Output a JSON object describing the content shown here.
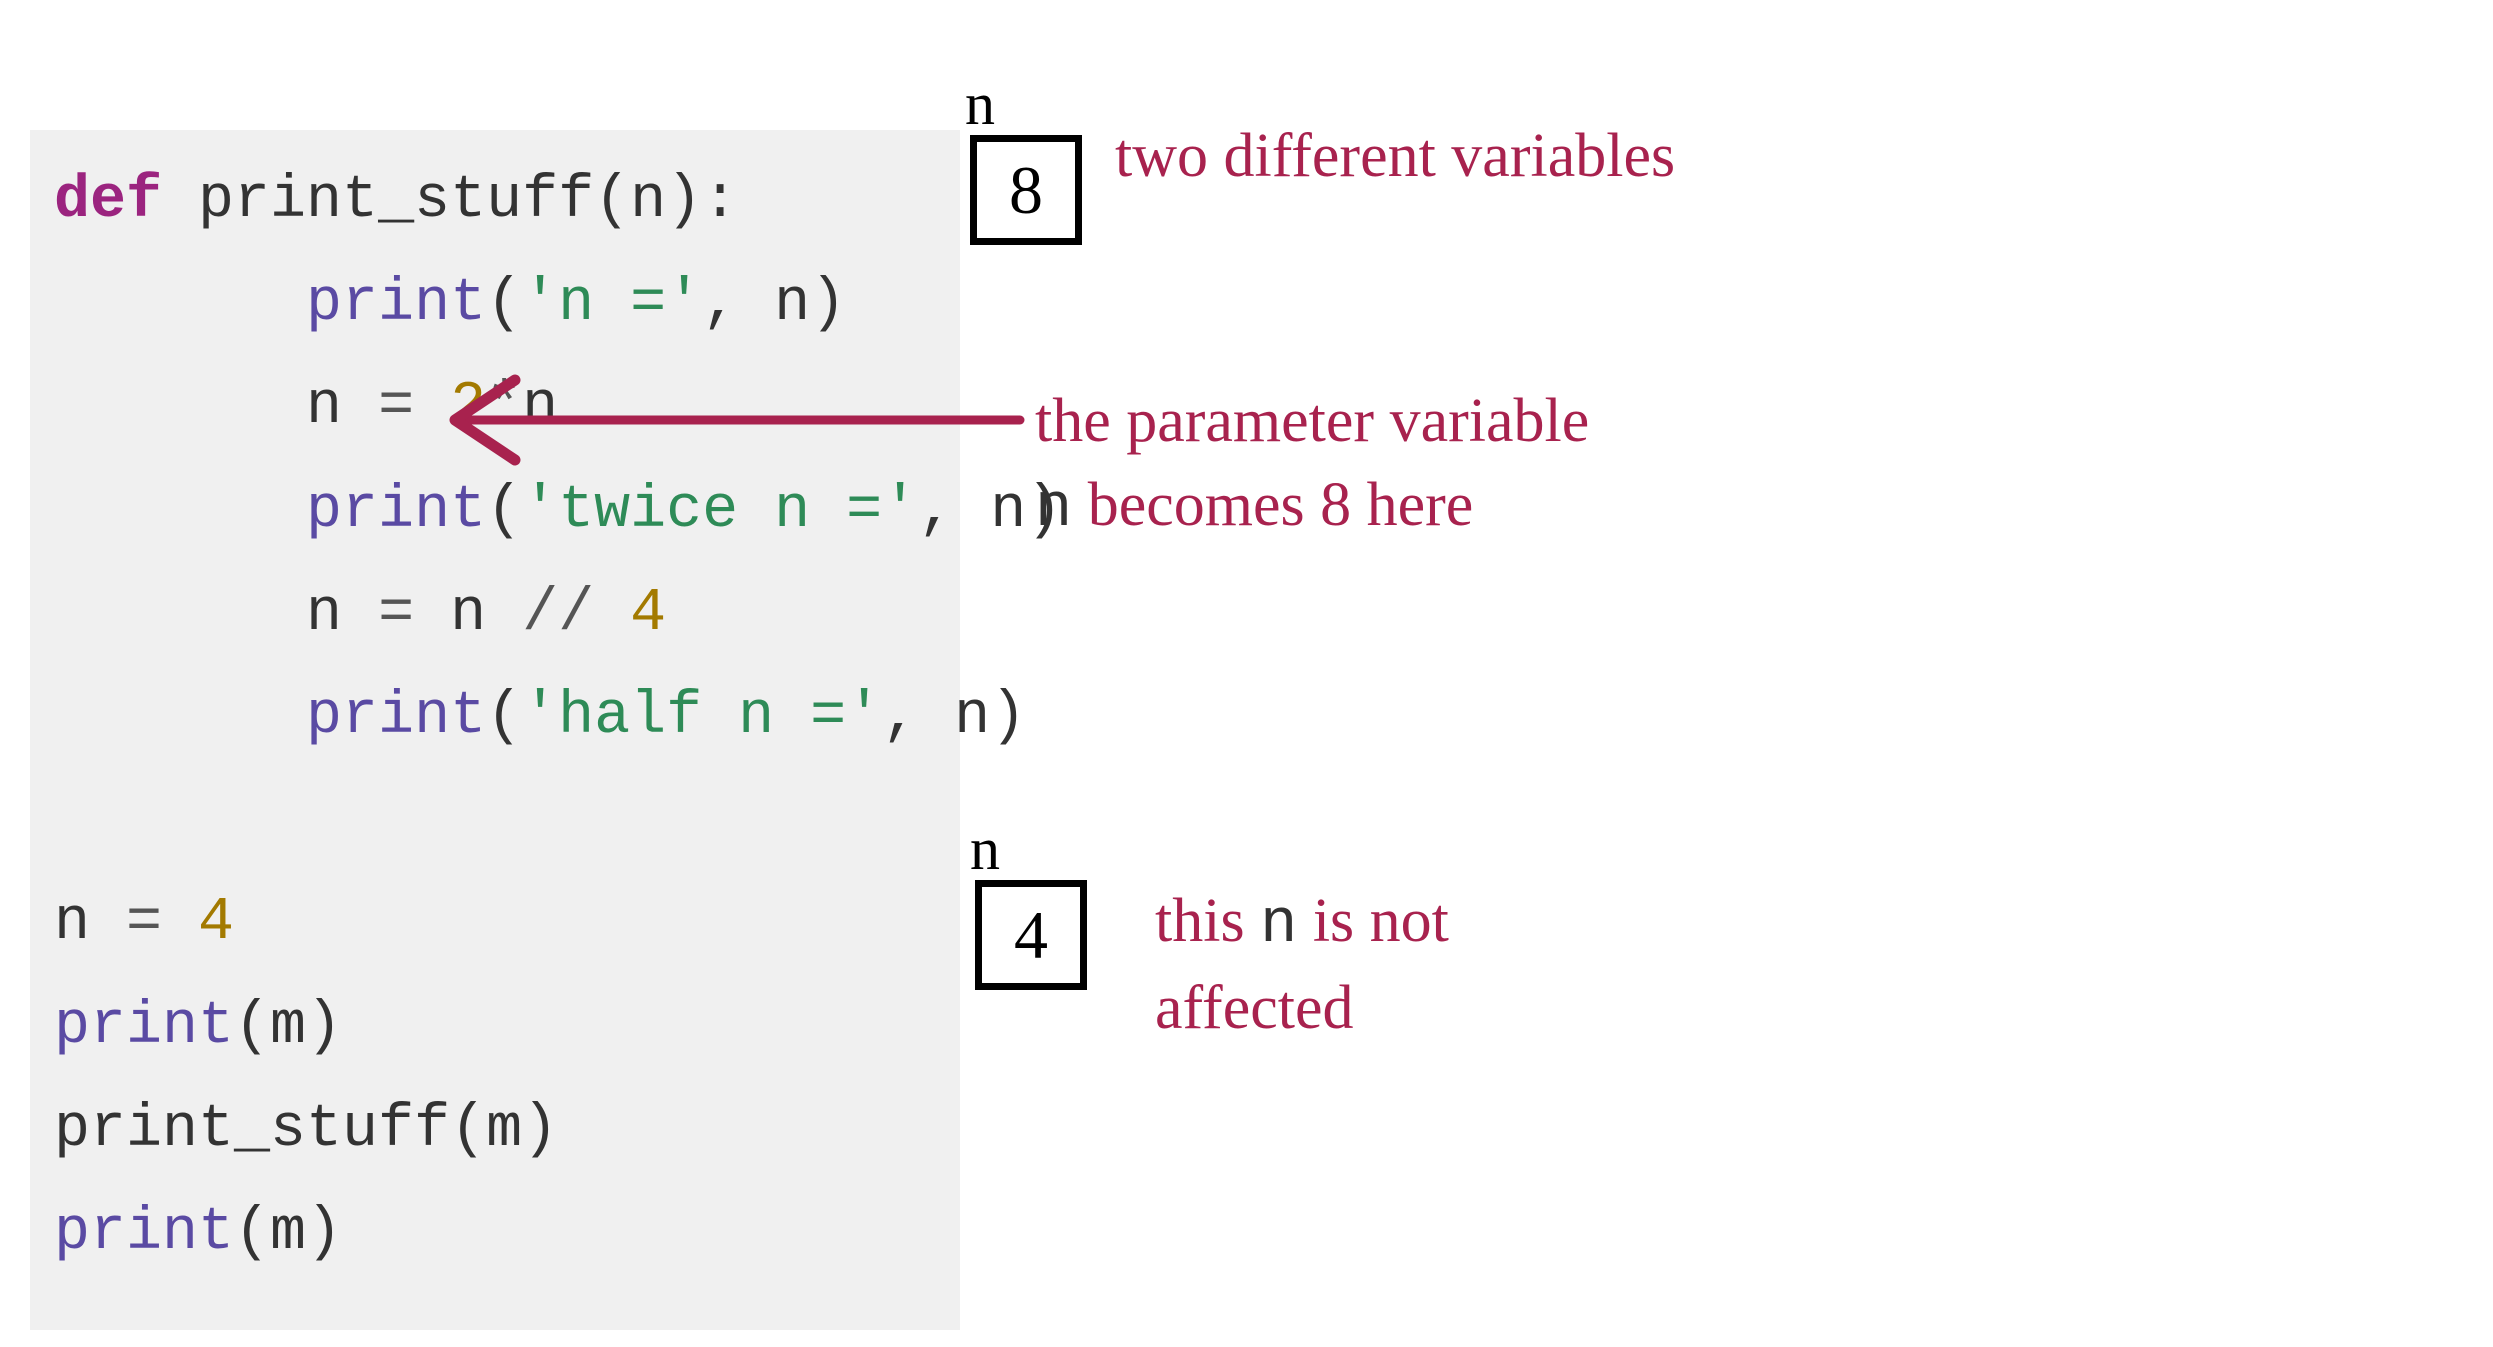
{
  "code": {
    "line1_def": "def",
    "line1_name": " print_stuff",
    "line1_paren_open": "(",
    "line1_param": "n",
    "line1_paren_close_colon": "):",
    "line2_indent": "       ",
    "line2_print": "print",
    "line2_open": "(",
    "line2_str": "'n ='",
    "line2_comma": ", ",
    "line2_arg": "n",
    "line2_close": ")",
    "line3_indent": "       ",
    "line3_lhs": "n ",
    "line3_eq": "=",
    "line3_space": " ",
    "line3_num": "2",
    "line3_mul": "*",
    "line3_rhs": "n",
    "line4_indent": "       ",
    "line4_print": "print",
    "line4_open": "(",
    "line4_str": "'twice n ='",
    "line4_comma": ", ",
    "line4_arg": "n",
    "line4_close": ")",
    "line5_indent": "       ",
    "line5_lhs": "n ",
    "line5_eq": "=",
    "line5_mid": " n ",
    "line5_div": "//",
    "line5_space": " ",
    "line5_num": "4",
    "line6_indent": "       ",
    "line6_print": "print",
    "line6_open": "(",
    "line6_str": "'half n ='",
    "line6_comma": ", ",
    "line6_arg": "n",
    "line6_close": ")",
    "line8_lhs": "n ",
    "line8_eq": "=",
    "line8_space": " ",
    "line8_num": "4",
    "line9_print": "print",
    "line9_open": "(",
    "line9_arg": "m",
    "line9_close": ")",
    "line10_call": "print_stuff",
    "line10_open": "(",
    "line10_arg": "m",
    "line10_close": ")",
    "line11_print": "print",
    "line11_open": "(",
    "line11_arg": "m",
    "line11_close": ")"
  },
  "annotations": {
    "box1_label": "n",
    "box1_value": "8",
    "note1": "two different variables",
    "note2a": "the parameter variable",
    "note2b_mono": "n",
    "note2b_rest": " becomes 8 here",
    "box2_label": "n",
    "box2_value": "4",
    "note3a": "this ",
    "note3a_mono": "n",
    "note3a_rest": " is not",
    "note3b": "affected"
  },
  "colors": {
    "hand": "#a8224e",
    "code_bg": "#f0f0f0"
  }
}
